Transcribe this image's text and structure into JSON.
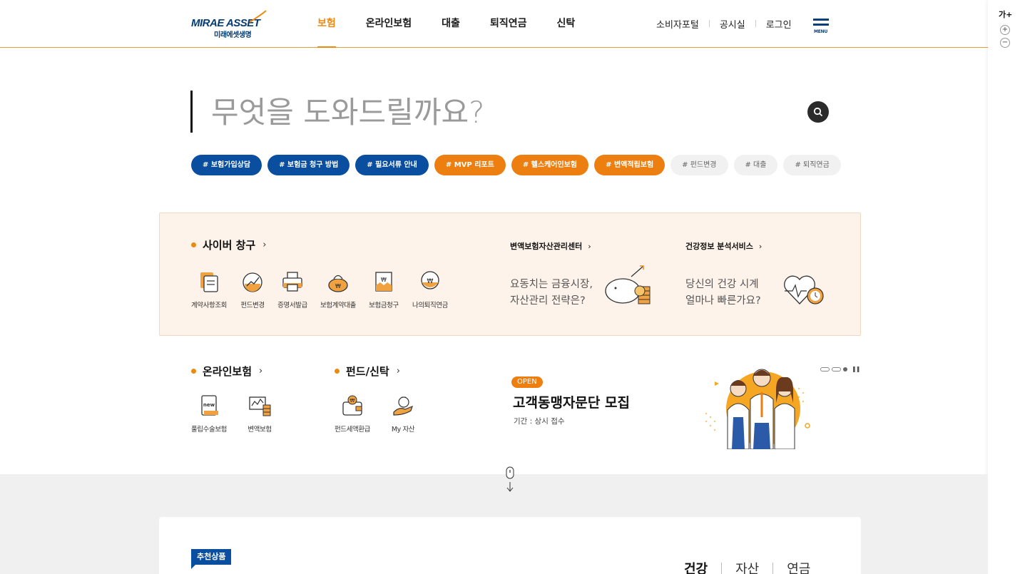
{
  "header": {
    "logo_en": "MIRAE ASSET",
    "logo_ko": "미래에셋생명",
    "nav": [
      "보험",
      "온라인보험",
      "대출",
      "퇴직연금",
      "신탁"
    ],
    "active_nav": "보험",
    "util": [
      "소비자포털",
      "공시실",
      "로그인"
    ],
    "menu_label": "MENU"
  },
  "side": {
    "font_size_label": "가+",
    "zoom_in": "+",
    "zoom_out": "−"
  },
  "search": {
    "placeholder": "무엇을 도와드릴까요?",
    "tags": [
      {
        "label": "# 보험가입상담",
        "style": "blue"
      },
      {
        "label": "# 보험금 청구 방법",
        "style": "blue"
      },
      {
        "label": "# 필요서류 안내",
        "style": "blue"
      },
      {
        "label": "# MVP 리포트",
        "style": "orange"
      },
      {
        "label": "# 헬스케어인보험",
        "style": "orange"
      },
      {
        "label": "# 변액적립보험",
        "style": "orange"
      },
      {
        "label": "# 펀드변경",
        "style": "gray"
      },
      {
        "label": "# 대출",
        "style": "gray"
      },
      {
        "label": "# 퇴직연금",
        "style": "gray"
      }
    ]
  },
  "cyber": {
    "title": "사이버 창구",
    "items": [
      {
        "label": "계약사항조회",
        "icon": "document-icon"
      },
      {
        "label": "펀드변경",
        "icon": "chart-up-icon"
      },
      {
        "label": "증명서발급",
        "icon": "printer-icon"
      },
      {
        "label": "보험계약대출",
        "icon": "money-pouch-icon"
      },
      {
        "label": "보험금청구",
        "icon": "claim-icon"
      },
      {
        "label": "나의퇴직연금",
        "icon": "pension-icon"
      }
    ],
    "promo1": {
      "title": "변액보험자산관리센터",
      "text1": "요동치는 금융시장,",
      "text2": "자산관리 전략은?"
    },
    "promo2": {
      "title": "건강정보 분석서비스",
      "text1": "당신의 건강 시계",
      "text2": "얼마나 빠른가요?"
    }
  },
  "online": {
    "title": "온라인보험",
    "items": [
      {
        "label": "풀립수술보험",
        "icon": "new-doc-icon"
      },
      {
        "label": "변액보험",
        "icon": "fund-coins-icon"
      }
    ]
  },
  "fund": {
    "title": "펀드/신탁",
    "items": [
      {
        "label": "펀드세액환급",
        "icon": "wallet-icon"
      },
      {
        "label": "My 자산",
        "icon": "hand-money-icon"
      }
    ]
  },
  "banner": {
    "badge": "OPEN",
    "title": "고객동맹자문단 모집",
    "period": "기간 : 상시 접수"
  },
  "recommend": {
    "badge": "추천상품",
    "tabs": [
      "건강",
      "자산",
      "연금"
    ],
    "active_tab": "건강"
  },
  "colors": {
    "brand_blue": "#0a4ea0",
    "brand_orange": "#ec8a10",
    "panel_bg": "#fdf3ea"
  }
}
